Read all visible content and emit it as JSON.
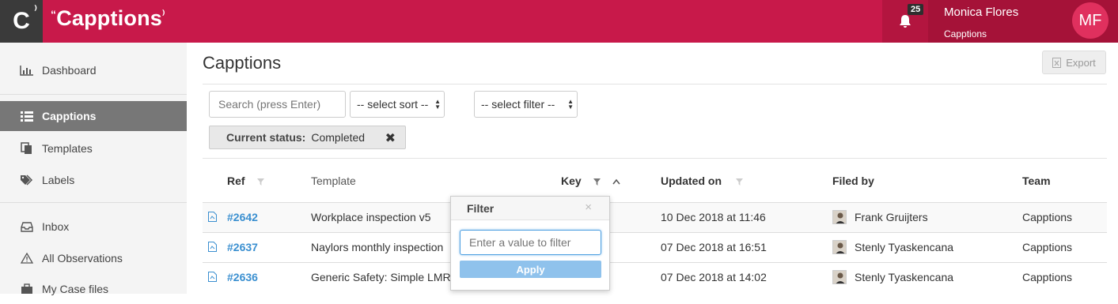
{
  "header": {
    "logo_glyph": "C",
    "logo_quote": "⁾",
    "brand_prefix": "“",
    "brand": "Capptions",
    "brand_suffix": "⁾",
    "notifications_count": "25",
    "user_name": "Monica Flores",
    "user_org": "Capptions",
    "user_initials": "MF",
    "brand_color": "#c8194a"
  },
  "sidebar": {
    "items": [
      {
        "label": "Dashboard",
        "icon": "bar-chart-icon"
      },
      {
        "label": "Capptions",
        "icon": "list-icon",
        "active": true
      },
      {
        "label": "Templates",
        "icon": "copy-icon"
      },
      {
        "label": "Labels",
        "icon": "tags-icon"
      },
      {
        "label": "Inbox",
        "icon": "inbox-icon"
      },
      {
        "label": "All Observations",
        "icon": "warning-icon"
      },
      {
        "label": "My Case files",
        "icon": "briefcase-icon"
      }
    ]
  },
  "main": {
    "title": "Capptions",
    "export_label": "Export",
    "search_placeholder": "Search (press Enter)",
    "sort_select": "-- select sort --",
    "filter_select": "-- select filter --",
    "status_chip": {
      "label": "Current status:",
      "value": "Completed"
    }
  },
  "table": {
    "columns": [
      "Ref",
      "Template",
      "Key",
      "Updated on",
      "Filed by",
      "Team"
    ],
    "rows": [
      {
        "ref": "#2642",
        "template": "Workplace inspection v5",
        "updated": "10 Dec 2018 at 11:46",
        "filed_by": "Frank Gruijters",
        "team": "Capptions"
      },
      {
        "ref": "#2637",
        "template": "Naylors monthly inspection",
        "updated": "07 Dec 2018 at 16:51",
        "filed_by": "Stenly Tyaskencana",
        "team": "Capptions"
      },
      {
        "ref": "#2636",
        "template": "Generic Safety: Simple LMRA",
        "updated": "07 Dec 2018 at 14:02",
        "filed_by": "Stenly Tyaskencana",
        "team": "Capptions"
      }
    ]
  },
  "filter_popover": {
    "title": "Filter",
    "close": "×",
    "placeholder": "Enter a value to filter",
    "apply_label": "Apply"
  }
}
